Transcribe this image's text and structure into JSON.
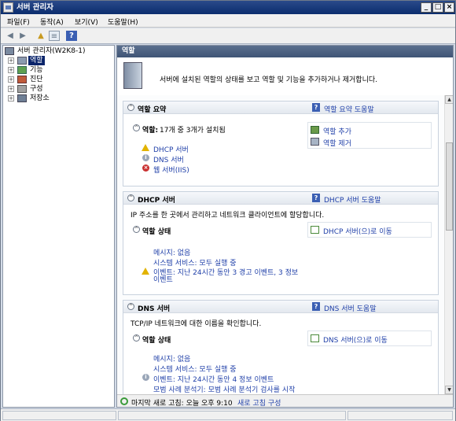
{
  "window": {
    "title": "서버 관리자"
  },
  "menu": [
    "파일(F)",
    "동작(A)",
    "보기(V)",
    "도움말(H)"
  ],
  "toolbar": {
    "icons": [
      "back-icon",
      "forward-icon",
      "up-folder-icon",
      "show-tree-icon",
      "help-icon"
    ]
  },
  "tree": {
    "root": "서버 관리자(W2K8-1)",
    "items": [
      "역할",
      "기능",
      "진단",
      "구성",
      "저장소"
    ]
  },
  "right": {
    "header": "역할",
    "intro": "서버에 설치된 역할의 상태를 보고 역할 및 기능을 추가하거나 제거합니다."
  },
  "summary": {
    "title": "역할 요약",
    "help": "역할 요약 도움말",
    "roles_label": "역할:",
    "roles_count": "17개 중 3개가 설치됨",
    "roles": [
      "DHCP 서버",
      "DNS 서버",
      "웹 서버(IIS)"
    ],
    "actions": [
      "역할 추가",
      "역할 제거"
    ]
  },
  "dhcp": {
    "title": "DHCP 서버",
    "help": "DHCP 서버 도움말",
    "desc": "IP 주소를 한 곳에서 관리하고 네트워크 클라이언트에 할당합니다.",
    "status_title": "역할 상태",
    "goto": "DHCP 서버(으)로 이동",
    "messages": "메시지: 없음",
    "services": "시스템 서비스: 모두 실행 중",
    "events_1": "이벤트: 지난 24시간 동안 3 경고 이벤트, 3 정보",
    "events_2": "이벤트"
  },
  "dns": {
    "title": "DNS 서버",
    "help": "DNS 서버 도움말",
    "desc": "TCP/IP 네트워크에 대한 이름을 확인합니다.",
    "status_title": "역할 상태",
    "goto": "DNS 서버(으)로 이동",
    "messages": "메시지: 없음",
    "services": "시스템 서비스: 모두 실행 중",
    "events": "이벤트: 지난 24시간 동안 4 정보 이벤트",
    "bpa": "모범 사례 분석기: 모범 사례 분석기 검사를 시작"
  },
  "status": {
    "last_refresh": "마지막 새로 고침: 오늘 오후 9:10",
    "configure": "새로 고침 구성"
  }
}
